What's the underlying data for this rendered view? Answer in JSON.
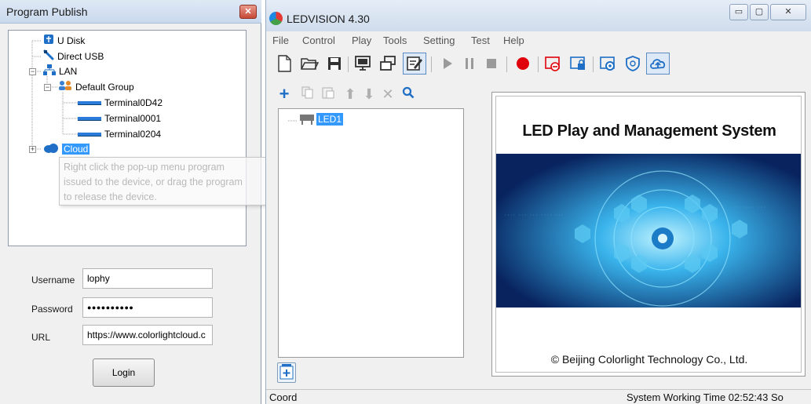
{
  "publish_window": {
    "title": "Program Publish",
    "close_icon": "close-icon",
    "tree": {
      "udisk": "U Disk",
      "direct_usb": "Direct USB",
      "lan": "LAN",
      "default_group": "Default Group",
      "terminals": [
        "Terminal0D42",
        "Terminal0001",
        "Terminal0204"
      ],
      "cloud": "Cloud"
    },
    "tooltip": {
      "line1": "Right click the pop-up menu program",
      "line2": "issued to the device, or drag the program",
      "line3": "to release the device."
    },
    "form": {
      "username_label": "Username",
      "username_value": "lophy",
      "password_label": "Password",
      "password_value": "●●●●●●●●●●",
      "url_label": "URL",
      "url_value": "https://www.colorlightcloud.c",
      "login_label": "Login"
    }
  },
  "main_window": {
    "title": "LEDVISION 4.30",
    "menu": [
      "File",
      "Control",
      "Play",
      "Tools",
      "Setting",
      "Test",
      "Help"
    ],
    "screen_tree": {
      "led_node": "LED1"
    },
    "splash": {
      "title": "LED Play and Management System",
      "copyright": "© Beijing Colorlight Technology Co., Ltd."
    },
    "status": {
      "left": "Coord",
      "right": "System Working Time 02:52:43 So"
    },
    "colors": {
      "selection": "#3399ff",
      "record": "#e0000b",
      "accent_blue": "#1e6fc5"
    }
  }
}
